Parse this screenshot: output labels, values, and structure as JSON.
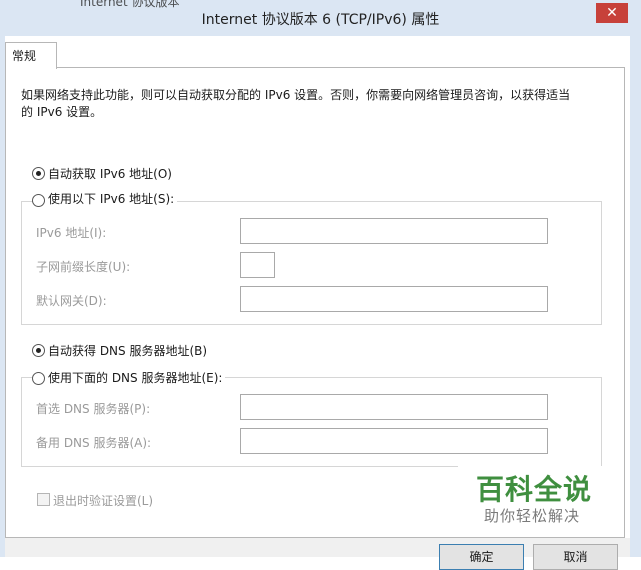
{
  "window": {
    "title": "Internet 协议版本 6 (TCP/IPv6) 属性",
    "background_window_text": "Internet 协议版本",
    "close_symbol": "✕"
  },
  "tabs": [
    {
      "label": "常规",
      "selected": true
    }
  ],
  "description": {
    "line1": "如果网络支持此功能，则可以自动获取分配的 IPv6 设置。否则，你需要向网络管理员咨询，以获得适当",
    "line2": "的 IPv6 设置。"
  },
  "ip_section": {
    "auto_radio": {
      "label": "自动获取 IPv6 地址(O)",
      "selected": true
    },
    "manual_radio": {
      "label": "使用以下 IPv6 地址(S):",
      "selected": false
    },
    "fields": [
      {
        "label": "IPv6 地址(I):",
        "value": "",
        "enabled": false
      },
      {
        "label": "子网前缀长度(U):",
        "value": "",
        "enabled": false
      },
      {
        "label": "默认网关(D):",
        "value": "",
        "enabled": false
      }
    ]
  },
  "dns_section": {
    "auto_radio": {
      "label": "自动获得 DNS 服务器地址(B)",
      "selected": true
    },
    "manual_radio": {
      "label": "使用下面的 DNS 服务器地址(E):",
      "selected": false
    },
    "fields": [
      {
        "label": "首选 DNS 服务器(P):",
        "value": "",
        "enabled": false
      },
      {
        "label": "备用 DNS 服务器(A):",
        "value": "",
        "enabled": false
      }
    ]
  },
  "validate_checkbox": {
    "label": "退出时验证设置(L)",
    "checked": false,
    "enabled": false
  },
  "buttons": {
    "ok": "确定",
    "cancel": "取消"
  },
  "watermark": {
    "title": "百科全说",
    "subtitle": "助你轻松解决"
  },
  "colors": {
    "titlebar": "#dbe6f3",
    "close": "#c7413a",
    "watermark": "#3f8f3f"
  }
}
